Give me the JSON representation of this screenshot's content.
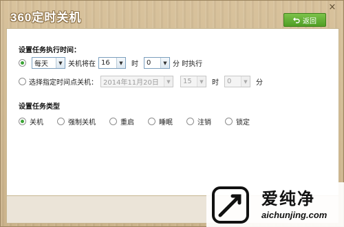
{
  "window": {
    "title": "360定时关机",
    "close_label": "×",
    "back_button": {
      "label": "返回",
      "icon": "back-arrow-icon"
    }
  },
  "schedule": {
    "section_title": "设置任务执行时间：",
    "option_daily": {
      "selected": true,
      "frequency": "每天",
      "text_before": "关机将在",
      "hour": "16",
      "hour_unit": "时",
      "minute": "0",
      "text_after": "分 时执行"
    },
    "option_specific": {
      "selected": false,
      "label": "选择指定时间点关机：",
      "date": "2014年11月20日",
      "hour": "15",
      "hour_unit": "时",
      "minute": "0",
      "minute_unit": "分"
    }
  },
  "task_type": {
    "section_title": "设置任务类型",
    "options": [
      {
        "label": "关机",
        "selected": true
      },
      {
        "label": "强制关机",
        "selected": false
      },
      {
        "label": "重启",
        "selected": false
      },
      {
        "label": "睡眠",
        "selected": false
      },
      {
        "label": "注销",
        "selected": false
      },
      {
        "label": "锁定",
        "selected": false
      }
    ]
  },
  "watermark": {
    "title": "爱纯净",
    "url": "aichunjing.com"
  },
  "colors": {
    "accent_green": "#3aa334",
    "back_button_green": "#5aa82c",
    "title_bar_wood": "#cbb38b"
  }
}
